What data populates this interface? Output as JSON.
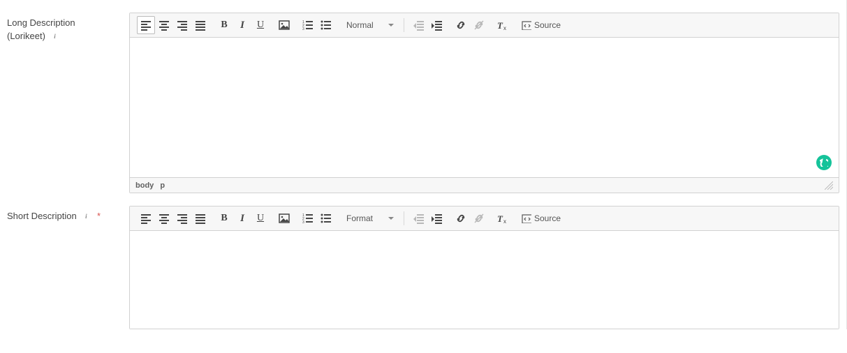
{
  "editors": {
    "long": {
      "label_line1": "Long Description",
      "label_line2": "(Lorikeet)",
      "required": false,
      "format_value": "Normal",
      "source_label": "Source",
      "status_path": [
        "body",
        "p"
      ],
      "content": "",
      "info_icon": "i"
    },
    "short": {
      "label": "Short Description",
      "required": true,
      "format_value": "Format",
      "source_label": "Source",
      "content": "",
      "info_icon": "i",
      "required_mark": "*"
    }
  },
  "icons": {
    "align_left": "align-left",
    "align_center": "align-center",
    "align_right": "align-right",
    "align_justify": "align-justify",
    "bold": "B",
    "italic": "I",
    "underline": "U",
    "image": "image",
    "ol": "numbered-list",
    "ul": "bullet-list",
    "outdent": "decrease-indent",
    "indent": "increase-indent",
    "link": "link",
    "unlink": "unlink",
    "remove_format": "remove-format",
    "source": "source-code"
  }
}
